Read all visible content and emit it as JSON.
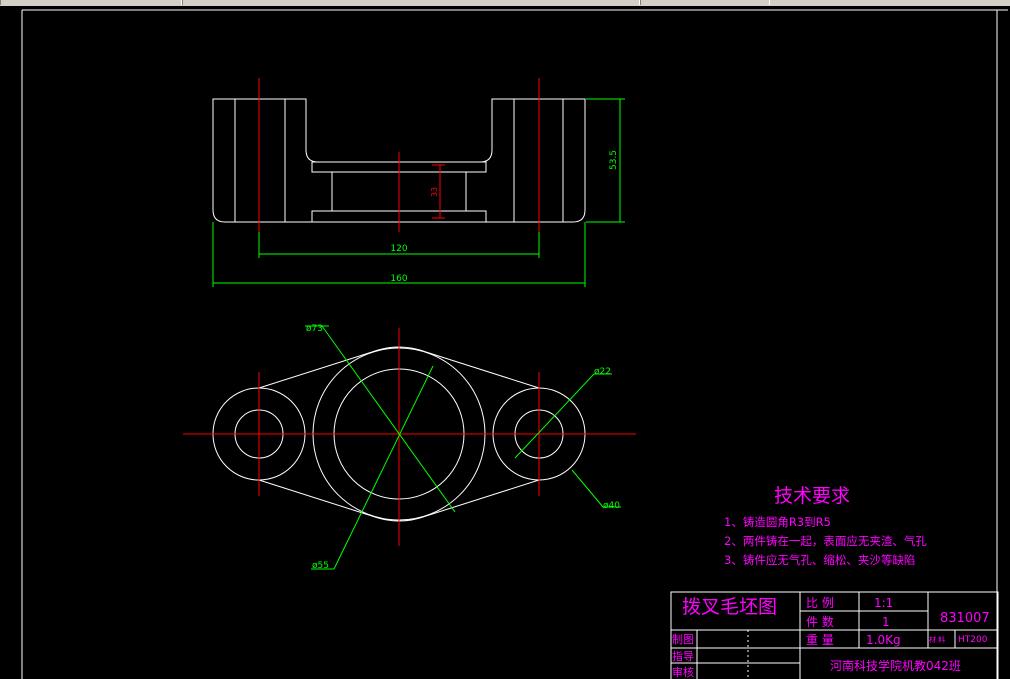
{
  "drawing": {
    "tech_requirements": {
      "heading": "技术要求",
      "items": [
        "1、铸造圆角R3到R5",
        "2、两件铸在一起，表面应无夹渣、气孔",
        "3、铸件应无气孔、缩松、夹沙等缺陷"
      ]
    },
    "dimensions": {
      "height": "53.5",
      "inner_height": "33",
      "inner_width": "120",
      "overall_width": "160",
      "dia_73": "ø73",
      "dia_55": "ø55",
      "dia_22": "ø22",
      "dia_40": "ø40"
    },
    "title_block": {
      "part_name": "拨叉毛坯图",
      "scale_label": "比 例",
      "scale_value": "1:1",
      "qty_label": "件 数",
      "qty_value": "1",
      "weight_label": "重 量",
      "weight_value": "1.0Kg",
      "drawing_no": "831007",
      "material_label": "材 料",
      "material_value": "HT200",
      "drawn_label": "制图",
      "guide_label": "指导",
      "check_label": "审核",
      "school": "河南科技学院机教042班"
    },
    "colors": {
      "background": "#000000",
      "outline": "#ffffff",
      "center_line": "#ff0000",
      "dimension": "#00ff00",
      "annotation": "#ff00ff"
    }
  }
}
